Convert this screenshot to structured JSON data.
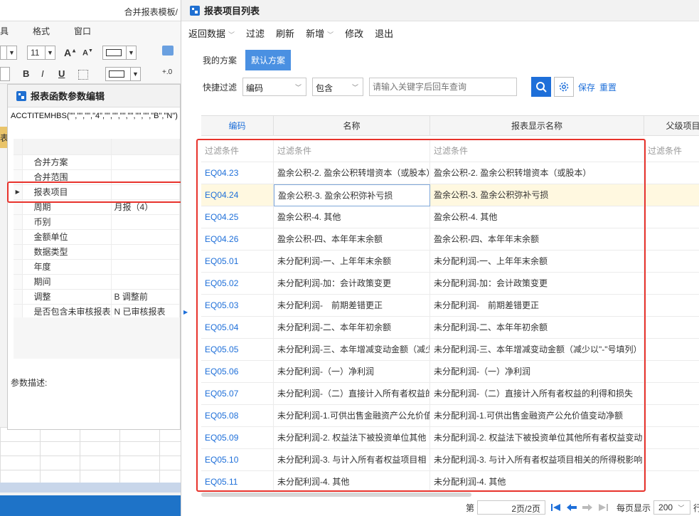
{
  "bg_app": {
    "title": "合并报表模板/",
    "menu": [
      "具",
      "格式",
      "窗口"
    ],
    "font_size": "11",
    "side_label": "表"
  },
  "param_dialog": {
    "title": "报表函数参数编辑",
    "formula": "ACCTITEMHBS(\"\",\"\",\"\",\"4\",\"\",\"\",\"\",\"\",\"\",\"\",\"B\",\"N\")",
    "rows": [
      {
        "name": "合并方案",
        "value": ""
      },
      {
        "name": "合并范围",
        "value": ""
      },
      {
        "name": "报表项目",
        "value": "",
        "current": true
      },
      {
        "name": "周期",
        "value": "月报（4）"
      },
      {
        "name": "币别",
        "value": ""
      },
      {
        "name": "金额单位",
        "value": ""
      },
      {
        "name": "数据类型",
        "value": ""
      },
      {
        "name": "年度",
        "value": ""
      },
      {
        "name": "期间",
        "value": ""
      },
      {
        "name": "调整",
        "value": "B  调整前"
      },
      {
        "name": "是否包含未审核报表",
        "value": "N  已审核报表"
      }
    ],
    "desc_label": "参数描述:"
  },
  "main": {
    "title": "报表项目列表",
    "toolbar": [
      {
        "label": "返回数据",
        "caret": true
      },
      {
        "label": "过滤",
        "caret": false
      },
      {
        "label": "刷新",
        "caret": false
      },
      {
        "label": "新增",
        "caret": true
      },
      {
        "label": "修改",
        "caret": false
      },
      {
        "label": "退出",
        "caret": false
      }
    ],
    "my_scheme": "我的方案",
    "default_scheme": "默认方案",
    "filter_label": "快捷过滤",
    "filter_field": "编码",
    "filter_op": "包含",
    "keyword_placeholder": "请输入关键字后回车查询",
    "save_label": "保存",
    "reset_label": "重置",
    "columns": [
      "编码",
      "名称",
      "报表显示名称",
      "父级项目"
    ],
    "filter_placeholder": "过滤条件",
    "rows": [
      {
        "code": "EQ04.23",
        "name": "盈余公积-2. 盈余公积转增资本（或股本）",
        "display": "盈余公积-2. 盈余公积转增资本（或股本）"
      },
      {
        "code": "EQ04.24",
        "name": "盈余公积-3. 盈余公积弥补亏损",
        "display": "盈余公积-3. 盈余公积弥补亏损",
        "selected": true
      },
      {
        "code": "EQ04.25",
        "name": "盈余公积-4. 其他",
        "display": "盈余公积-4. 其他"
      },
      {
        "code": "EQ04.26",
        "name": "盈余公积-四、本年年末余额",
        "display": "盈余公积-四、本年年末余额"
      },
      {
        "code": "EQ05.01",
        "name": "未分配利润-一、上年年末余额",
        "display": "未分配利润-一、上年年末余额"
      },
      {
        "code": "EQ05.02",
        "name": "未分配利润-加：会计政策变更",
        "display": "未分配利润-加：会计政策变更"
      },
      {
        "code": "EQ05.03",
        "name": "未分配利润-　前期差错更正",
        "display": "未分配利润-　前期差错更正"
      },
      {
        "code": "EQ05.04",
        "name": "未分配利润-二、本年年初余额",
        "display": "未分配利润-二、本年年初余额"
      },
      {
        "code": "EQ05.05",
        "name": "未分配利润-三、本年增减变动金额（减少",
        "display": "未分配利润-三、本年增减变动金额（减少以\"-\"号填列）"
      },
      {
        "code": "EQ05.06",
        "name": "未分配利润-（一）净利润",
        "display": "未分配利润-（一）净利润"
      },
      {
        "code": "EQ05.07",
        "name": "未分配利润-（二）直接计入所有者权益的",
        "display": "未分配利润-（二）直接计入所有者权益的利得和损失"
      },
      {
        "code": "EQ05.08",
        "name": "未分配利润-1.可供出售金融资产公允价值",
        "display": "未分配利润-1.可供出售金融资产公允价值变动净额"
      },
      {
        "code": "EQ05.09",
        "name": "未分配利润-2. 权益法下被投资单位其他",
        "display": "未分配利润-2. 权益法下被投资单位其他所有者权益变动"
      },
      {
        "code": "EQ05.10",
        "name": "未分配利润-3. 与计入所有者权益项目相",
        "display": "未分配利润-3. 与计入所有者权益项目相关的所得税影响"
      },
      {
        "code": "EQ05.11",
        "name": "未分配利润-4. 其他",
        "display": "未分配利润-4. 其他"
      }
    ],
    "pager": {
      "prefix": "第",
      "page_text": "2页/2页",
      "per_page_label": "每页显示",
      "page_size": "200",
      "suffix": "行"
    }
  },
  "colors": {
    "accent": "#1e6fd9",
    "highlight_red": "#e8332c",
    "selected_row": "#fff8e0"
  }
}
